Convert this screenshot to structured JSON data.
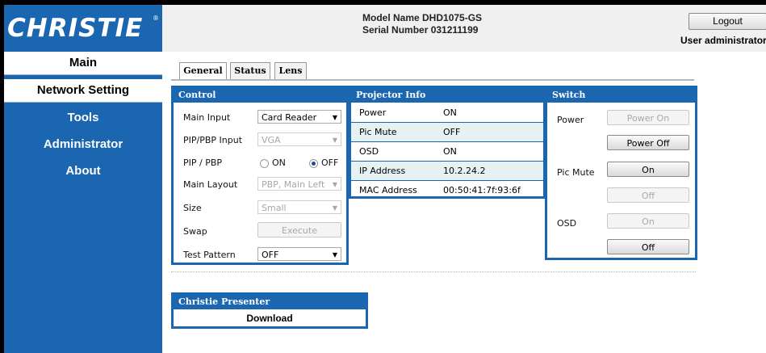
{
  "brand": {
    "logo": "CHRISTIE",
    "reg": "®"
  },
  "header": {
    "model_line": "Model Name DHD1075-GS",
    "serial_line": "Serial Number 031211199",
    "logout_label": "Logout",
    "user_label": "User administrator"
  },
  "nav": {
    "main": "Main",
    "network": "Network Setting",
    "tools": "Tools",
    "admin": "Administrator",
    "about": "About"
  },
  "tabs": {
    "general": "General",
    "status": "Status",
    "lens": "Lens"
  },
  "control": {
    "title": "Control",
    "main_input_label": "Main Input",
    "main_input_value": "Card Reader",
    "pip_input_label": "PIP/PBP Input",
    "pip_input_value": "VGA",
    "pip_pbp_label": "PIP / PBP",
    "radio_on": "ON",
    "radio_off": "OFF",
    "layout_label": "Main Layout",
    "layout_value": "PBP, Main Left",
    "size_label": "Size",
    "size_value": "Small",
    "swap_label": "Swap",
    "swap_button": "Execute",
    "test_label": "Test Pattern",
    "test_value": "OFF"
  },
  "projector_info": {
    "title": "Projector Info",
    "rows": [
      {
        "label": "Power",
        "value": "ON"
      },
      {
        "label": "Pic Mute",
        "value": "OFF"
      },
      {
        "label": "OSD",
        "value": "ON"
      },
      {
        "label": "IP Address",
        "value": "10.2.24.2"
      },
      {
        "label": "MAC Address",
        "value": "00:50:41:7f:93:6f"
      }
    ]
  },
  "switch": {
    "title": "Switch",
    "power_label": "Power",
    "power_on": "Power On",
    "power_off": "Power Off",
    "picmute_label": "Pic Mute",
    "picmute_on": "On",
    "picmute_off": "Off",
    "osd_label": "OSD",
    "osd_on": "On",
    "osd_off": "Off"
  },
  "presenter": {
    "title": "Christie Presenter",
    "download": "Download"
  },
  "colors": {
    "nav_blue": "#1a66b0",
    "row_alt": "#e6f2f2"
  }
}
